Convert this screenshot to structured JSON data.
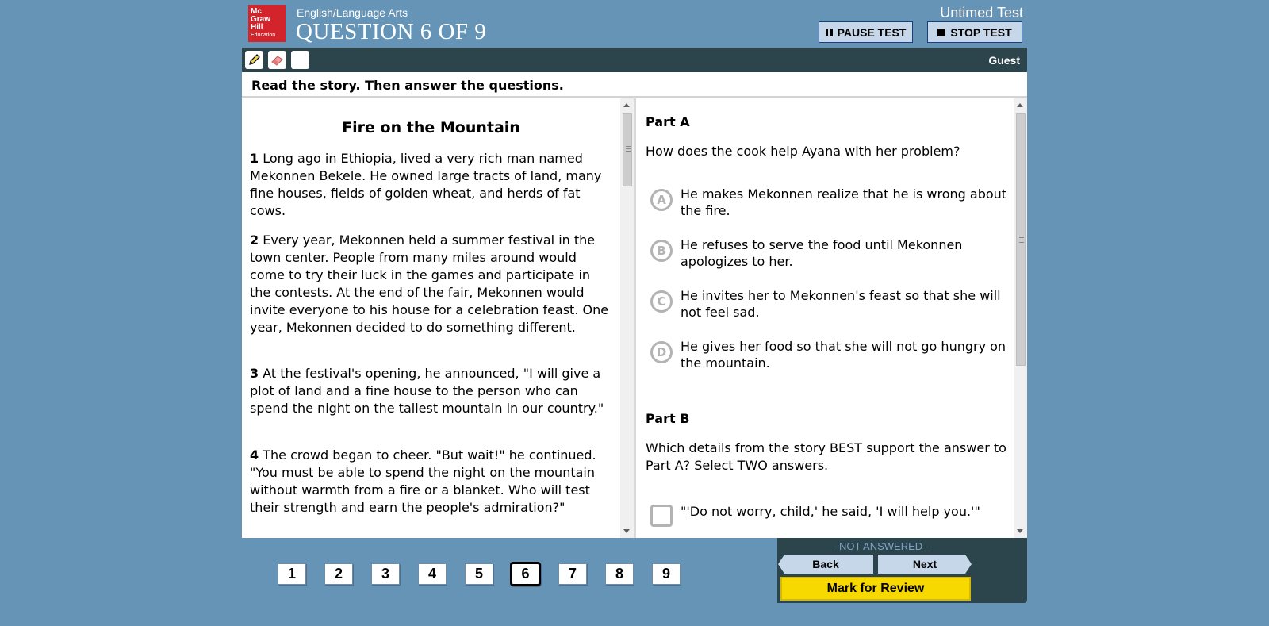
{
  "header": {
    "logo_lines": [
      "Mc",
      "Graw",
      "Hill",
      "Education"
    ],
    "subject": "English/Language Arts",
    "question_title": "QUESTION 6 OF 9",
    "timer_label": "Untimed Test",
    "pause_label": "PAUSE TEST",
    "stop_label": "STOP TEST"
  },
  "toolbar": {
    "tools": [
      "pencil-icon",
      "eraser-icon",
      "blank-tool"
    ],
    "user": "Guest"
  },
  "instructions": "Read the story. Then answer the questions.",
  "passage": {
    "title": "Fire on the Mountain",
    "paragraphs": [
      {
        "num": "1",
        "text": " Long ago in Ethiopia, lived a very rich man named Mekonnen Bekele. He owned large tracts of land, many fine houses, fields of golden wheat, and herds of fat cows."
      },
      {
        "num": "2",
        "text": " Every year, Mekonnen held a summer festival in the town center. People from many miles around would come to try their luck in the games and participate in the contests. At the end of the fair, Mekonnen would invite everyone to his house for a celebration feast. One year, Mekonnen decided to do something different."
      },
      {
        "num": "3",
        "text": " At the festival's opening, he announced, \"I will give a plot of land and a fine house to the person who can spend the night on the tallest mountain in our country.\""
      },
      {
        "num": "4",
        "text": " The crowd began to cheer. \"But wait!\" he continued. \"You must be able to spend the night on the mountain without warmth from a fire or a blanket. Who will test their strength and earn the people's admiration?\""
      }
    ]
  },
  "questions": {
    "part_a": {
      "label": "Part A",
      "prompt": "How does the cook help Ayana with her problem?",
      "choices": [
        {
          "letter": "A",
          "text": "He makes Mekonnen realize that he is wrong about the fire."
        },
        {
          "letter": "B",
          "text": "He refuses to serve the food until Mekonnen apologizes to her."
        },
        {
          "letter": "C",
          "text": "He invites her to Mekonnen's feast so that she will not feel sad."
        },
        {
          "letter": "D",
          "text": "He gives her food so that she will not go hungry on the mountain."
        }
      ]
    },
    "part_b": {
      "label": "Part B",
      "prompt": "Which details from the story BEST support the answer to Part A? Select TWO answers.",
      "choices": [
        {
          "text": "\"'Do not worry, child,' he said, 'I will help you.'\""
        }
      ]
    }
  },
  "footer": {
    "status": "- NOT ANSWERED -",
    "back_label": "Back",
    "next_label": "Next",
    "review_label": "Mark for Review",
    "question_numbers": [
      "1",
      "2",
      "3",
      "4",
      "5",
      "6",
      "7",
      "8",
      "9"
    ],
    "current_question": "6"
  },
  "colors": {
    "background": "#6594b6",
    "toolbar": "#2c444c",
    "logo_red": "#d3232b",
    "review_yellow": "#f7d900",
    "button_light": "#c7d7ea"
  }
}
